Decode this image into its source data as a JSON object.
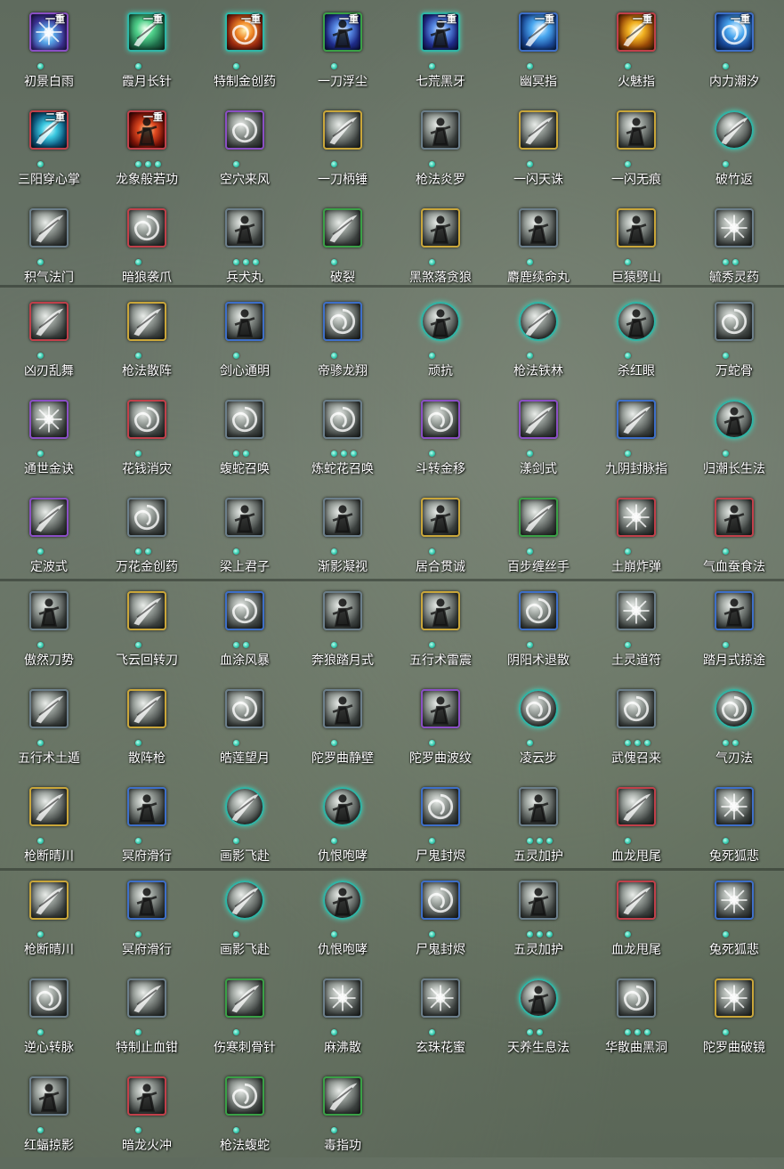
{
  "skills": [
    {
      "name": "初景白雨",
      "frame": "purple",
      "color": "purple",
      "badge": "一重",
      "dots": 1,
      "shape": "burst"
    },
    {
      "name": "霞月长针",
      "frame": "teal",
      "color": "green",
      "badge": "一重",
      "dots": 1,
      "shape": "slash"
    },
    {
      "name": "特制金创药",
      "frame": "teal",
      "color": "orange",
      "badge": "一重",
      "dots": 1,
      "shape": "swirl"
    },
    {
      "name": "一刀浮尘",
      "frame": "green",
      "color": "blue",
      "badge": "一重",
      "dots": 1,
      "shape": "figure"
    },
    {
      "name": "七荒黑牙",
      "frame": "teal",
      "color": "blue",
      "badge": "二重",
      "dots": 1,
      "shape": "figure"
    },
    {
      "name": "幽冥指",
      "frame": "blue",
      "color": "blue2",
      "badge": "一重",
      "dots": 1,
      "shape": "slash"
    },
    {
      "name": "火魅指",
      "frame": "red",
      "color": "gold",
      "badge": "一重",
      "dots": 1,
      "shape": "slash"
    },
    {
      "name": "内力潮汐",
      "frame": "blue",
      "color": "blue2",
      "badge": "一重",
      "dots": 1,
      "shape": "swirl"
    },
    {
      "name": "三阳穿心掌",
      "frame": "red",
      "color": "cyan",
      "badge": "二重",
      "dots": 1,
      "shape": "slash"
    },
    {
      "name": "龙象般若功",
      "frame": "red",
      "color": "fire",
      "badge": "一重",
      "dots": 3,
      "shape": "figure"
    },
    {
      "name": "空穴来风",
      "frame": "purple",
      "color": "",
      "badge": "",
      "dots": 1,
      "shape": "swirl"
    },
    {
      "name": "一刀柄锤",
      "frame": "gold",
      "color": "",
      "badge": "",
      "dots": 1,
      "shape": "slash"
    },
    {
      "name": "枪法炎罗",
      "frame": "grey",
      "color": "",
      "badge": "",
      "dots": 1,
      "shape": "figure"
    },
    {
      "name": "一闪天诛",
      "frame": "gold",
      "color": "",
      "badge": "",
      "dots": 1,
      "shape": "slash"
    },
    {
      "name": "一闪无痕",
      "frame": "gold",
      "color": "",
      "badge": "",
      "dots": 1,
      "shape": "figure"
    },
    {
      "name": "破竹返",
      "frame": "teal",
      "color": "",
      "badge": "",
      "dots": 1,
      "shape": "slash",
      "round": true
    },
    {
      "name": "积气法门",
      "frame": "grey",
      "color": "",
      "badge": "",
      "dots": 1,
      "shape": "slash"
    },
    {
      "name": "暗狼袭爪",
      "frame": "red",
      "color": "",
      "badge": "",
      "dots": 1,
      "shape": "swirl"
    },
    {
      "name": "兵犬丸",
      "frame": "grey",
      "color": "",
      "badge": "",
      "dots": 3,
      "shape": "figure"
    },
    {
      "name": "破裂",
      "frame": "green",
      "color": "",
      "badge": "",
      "dots": 1,
      "shape": "slash"
    },
    {
      "name": "黑煞落贪狼",
      "frame": "gold",
      "color": "",
      "badge": "",
      "dots": 1,
      "shape": "figure"
    },
    {
      "name": "麝鹿续命丸",
      "frame": "grey",
      "color": "",
      "badge": "",
      "dots": 1,
      "shape": "figure"
    },
    {
      "name": "巨猿劈山",
      "frame": "gold",
      "color": "",
      "badge": "",
      "dots": 1,
      "shape": "figure"
    },
    {
      "name": "毓秀灵药",
      "frame": "grey",
      "color": "",
      "badge": "",
      "dots": 2,
      "shape": "burst"
    },
    {
      "name": "凶刃乱舞",
      "frame": "red",
      "color": "",
      "badge": "",
      "dots": 1,
      "shape": "slash"
    },
    {
      "name": "枪法散阵",
      "frame": "gold",
      "color": "",
      "badge": "",
      "dots": 1,
      "shape": "slash"
    },
    {
      "name": "剑心通明",
      "frame": "blue",
      "color": "",
      "badge": "",
      "dots": 1,
      "shape": "figure"
    },
    {
      "name": "帝骖龙翔",
      "frame": "blue",
      "color": "",
      "badge": "",
      "dots": 1,
      "shape": "swirl"
    },
    {
      "name": "顽抗",
      "frame": "teal",
      "color": "",
      "badge": "",
      "dots": 1,
      "shape": "figure",
      "round": true
    },
    {
      "name": "枪法铁林",
      "frame": "teal",
      "color": "",
      "badge": "",
      "dots": 1,
      "shape": "slash",
      "round": true
    },
    {
      "name": "杀红眼",
      "frame": "teal",
      "color": "",
      "badge": "",
      "dots": 1,
      "shape": "figure",
      "round": true
    },
    {
      "name": "万蛇骨",
      "frame": "grey",
      "color": "",
      "badge": "",
      "dots": 1,
      "shape": "swirl"
    },
    {
      "name": "通世金诀",
      "frame": "purple",
      "color": "",
      "badge": "",
      "dots": 1,
      "shape": "burst"
    },
    {
      "name": "花钱消灾",
      "frame": "red",
      "color": "",
      "badge": "",
      "dots": 1,
      "shape": "swirl"
    },
    {
      "name": "蝮蛇召唤",
      "frame": "grey",
      "color": "",
      "badge": "",
      "dots": 2,
      "shape": "swirl"
    },
    {
      "name": "炼蛇花召唤",
      "frame": "grey",
      "color": "",
      "badge": "",
      "dots": 3,
      "shape": "swirl"
    },
    {
      "name": "斗转金移",
      "frame": "purple",
      "color": "",
      "badge": "",
      "dots": 1,
      "shape": "swirl"
    },
    {
      "name": "漾剑式",
      "frame": "purple",
      "color": "",
      "badge": "",
      "dots": 1,
      "shape": "slash"
    },
    {
      "name": "九阴封脉指",
      "frame": "blue",
      "color": "",
      "badge": "",
      "dots": 1,
      "shape": "slash"
    },
    {
      "name": "归潮长生法",
      "frame": "teal",
      "color": "",
      "badge": "",
      "dots": 1,
      "shape": "figure",
      "round": true
    },
    {
      "name": "定波式",
      "frame": "purple",
      "color": "",
      "badge": "",
      "dots": 1,
      "shape": "slash"
    },
    {
      "name": "万花金创药",
      "frame": "grey",
      "color": "",
      "badge": "",
      "dots": 2,
      "shape": "swirl"
    },
    {
      "name": "梁上君子",
      "frame": "grey",
      "color": "",
      "badge": "",
      "dots": 1,
      "shape": "figure"
    },
    {
      "name": "渐影凝视",
      "frame": "grey",
      "color": "",
      "badge": "",
      "dots": 1,
      "shape": "figure"
    },
    {
      "name": "居合贯诚",
      "frame": "gold",
      "color": "",
      "badge": "",
      "dots": 1,
      "shape": "figure"
    },
    {
      "name": "百步缠丝手",
      "frame": "green",
      "color": "",
      "badge": "",
      "dots": 1,
      "shape": "slash"
    },
    {
      "name": "土崩炸弹",
      "frame": "red",
      "color": "",
      "badge": "",
      "dots": 1,
      "shape": "burst"
    },
    {
      "name": "气血蚕食法",
      "frame": "red",
      "color": "",
      "badge": "",
      "dots": 1,
      "shape": "figure"
    },
    {
      "name": "傲然刀势",
      "frame": "grey",
      "color": "",
      "badge": "",
      "dots": 1,
      "shape": "figure"
    },
    {
      "name": "飞云回转刀",
      "frame": "gold",
      "color": "",
      "badge": "",
      "dots": 1,
      "shape": "slash"
    },
    {
      "name": "血涂风暴",
      "frame": "blue",
      "color": "",
      "badge": "",
      "dots": 2,
      "shape": "swirl"
    },
    {
      "name": "奔狼踏月式",
      "frame": "grey",
      "color": "",
      "badge": "",
      "dots": 1,
      "shape": "figure"
    },
    {
      "name": "五行术雷震",
      "frame": "gold",
      "color": "",
      "badge": "",
      "dots": 1,
      "shape": "figure"
    },
    {
      "name": "阴阳术退散",
      "frame": "blue",
      "color": "",
      "badge": "",
      "dots": 1,
      "shape": "swirl"
    },
    {
      "name": "土灵道符",
      "frame": "grey",
      "color": "",
      "badge": "",
      "dots": 1,
      "shape": "burst"
    },
    {
      "name": "踏月式掠途",
      "frame": "blue",
      "color": "",
      "badge": "",
      "dots": 1,
      "shape": "figure"
    },
    {
      "name": "五行术土遁",
      "frame": "grey",
      "color": "",
      "badge": "",
      "dots": 1,
      "shape": "slash"
    },
    {
      "name": "散阵枪",
      "frame": "gold",
      "color": "",
      "badge": "",
      "dots": 1,
      "shape": "slash"
    },
    {
      "name": "皓莲望月",
      "frame": "grey",
      "color": "",
      "badge": "",
      "dots": 1,
      "shape": "swirl"
    },
    {
      "name": "陀罗曲静壁",
      "frame": "grey",
      "color": "",
      "badge": "",
      "dots": 1,
      "shape": "figure"
    },
    {
      "name": "陀罗曲波纹",
      "frame": "purple",
      "color": "",
      "badge": "",
      "dots": 1,
      "shape": "figure"
    },
    {
      "name": "凌云步",
      "frame": "teal",
      "color": "",
      "badge": "",
      "dots": 1,
      "shape": "swirl",
      "round": true
    },
    {
      "name": "武傀召来",
      "frame": "grey",
      "color": "",
      "badge": "",
      "dots": 3,
      "shape": "swirl"
    },
    {
      "name": "气刃法",
      "frame": "teal",
      "color": "",
      "badge": "",
      "dots": 2,
      "shape": "swirl",
      "round": true
    },
    {
      "name": "枪断晴川",
      "frame": "gold",
      "color": "",
      "badge": "",
      "dots": 1,
      "shape": "slash"
    },
    {
      "name": "冥府滑行",
      "frame": "blue",
      "color": "",
      "badge": "",
      "dots": 1,
      "shape": "figure"
    },
    {
      "name": "画影飞赴",
      "frame": "teal",
      "color": "",
      "badge": "",
      "dots": 1,
      "shape": "slash",
      "round": true
    },
    {
      "name": "仇恨咆哮",
      "frame": "teal",
      "color": "",
      "badge": "",
      "dots": 1,
      "shape": "figure",
      "round": true
    },
    {
      "name": "尸鬼封烬",
      "frame": "blue",
      "color": "",
      "badge": "",
      "dots": 1,
      "shape": "swirl"
    },
    {
      "name": "五灵加护",
      "frame": "grey",
      "color": "",
      "badge": "",
      "dots": 3,
      "shape": "figure"
    },
    {
      "name": "血龙甩尾",
      "frame": "red",
      "color": "",
      "badge": "",
      "dots": 1,
      "shape": "slash"
    },
    {
      "name": "兔死狐悲",
      "frame": "blue",
      "color": "",
      "badge": "",
      "dots": 1,
      "shape": "burst"
    },
    {
      "name": "枪断晴川",
      "frame": "gold",
      "color": "",
      "badge": "",
      "dots": 1,
      "shape": "slash"
    },
    {
      "name": "冥府滑行",
      "frame": "blue",
      "color": "",
      "badge": "",
      "dots": 1,
      "shape": "figure"
    },
    {
      "name": "画影飞赴",
      "frame": "teal",
      "color": "",
      "badge": "",
      "dots": 1,
      "shape": "slash",
      "round": true
    },
    {
      "name": "仇恨咆哮",
      "frame": "teal",
      "color": "",
      "badge": "",
      "dots": 1,
      "shape": "figure",
      "round": true
    },
    {
      "name": "尸鬼封烬",
      "frame": "blue",
      "color": "",
      "badge": "",
      "dots": 1,
      "shape": "swirl"
    },
    {
      "name": "五灵加护",
      "frame": "grey",
      "color": "",
      "badge": "",
      "dots": 3,
      "shape": "figure"
    },
    {
      "name": "血龙甩尾",
      "frame": "red",
      "color": "",
      "badge": "",
      "dots": 1,
      "shape": "slash"
    },
    {
      "name": "兔死狐悲",
      "frame": "blue",
      "color": "",
      "badge": "",
      "dots": 1,
      "shape": "burst"
    },
    {
      "name": "逆心转脉",
      "frame": "grey",
      "color": "",
      "badge": "",
      "dots": 1,
      "shape": "swirl"
    },
    {
      "name": "特制止血钳",
      "frame": "grey",
      "color": "",
      "badge": "",
      "dots": 1,
      "shape": "slash"
    },
    {
      "name": "伤寒刺骨针",
      "frame": "green",
      "color": "",
      "badge": "",
      "dots": 1,
      "shape": "slash"
    },
    {
      "name": "麻沸散",
      "frame": "grey",
      "color": "",
      "badge": "",
      "dots": 1,
      "shape": "burst"
    },
    {
      "name": "玄珠花蜜",
      "frame": "grey",
      "color": "",
      "badge": "",
      "dots": 1,
      "shape": "burst"
    },
    {
      "name": "天养生息法",
      "frame": "teal",
      "color": "",
      "badge": "",
      "dots": 2,
      "shape": "figure",
      "round": true
    },
    {
      "name": "华散曲黑洞",
      "frame": "grey",
      "color": "",
      "badge": "",
      "dots": 3,
      "shape": "swirl"
    },
    {
      "name": "陀罗曲破镜",
      "frame": "gold",
      "color": "",
      "badge": "",
      "dots": 1,
      "shape": "burst"
    },
    {
      "name": "红蝠掠影",
      "frame": "grey",
      "color": "",
      "badge": "",
      "dots": 1,
      "shape": "figure"
    },
    {
      "name": "暗龙火冲",
      "frame": "red",
      "color": "",
      "badge": "",
      "dots": 1,
      "shape": "figure"
    },
    {
      "name": "枪法蝮蛇",
      "frame": "green",
      "color": "",
      "badge": "",
      "dots": 1,
      "shape": "swirl"
    },
    {
      "name": "毒指功",
      "frame": "green",
      "color": "",
      "badge": "",
      "dots": 1,
      "shape": "slash"
    }
  ]
}
